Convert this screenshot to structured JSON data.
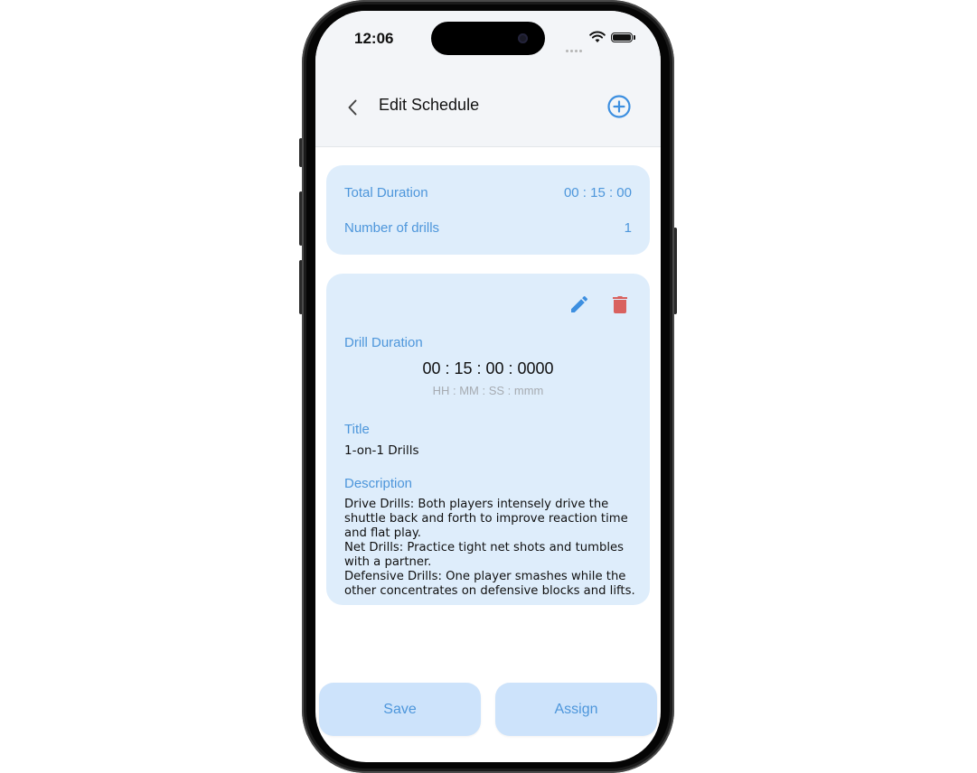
{
  "status_bar": {
    "time": "12:06"
  },
  "nav": {
    "title": "Edit Schedule"
  },
  "summary": {
    "total_duration_label": "Total Duration",
    "total_duration_value": "00 : 15 : 00",
    "drills_count_label": "Number of drills",
    "drills_count_value": "1"
  },
  "drill": {
    "duration_label": "Drill Duration",
    "duration_value": "00 : 15 : 00 : 0000",
    "duration_format": "HH : MM : SS : mmm",
    "title_label": "Title",
    "title_value": "1-on-1 Drills",
    "description_label": "Description",
    "description_value": "Drive Drills: Both players intensely drive the shuttle back and forth to improve reaction time and flat play.\nNet Drills: Practice tight net shots and tumbles with a partner.\nDefensive Drills: One player smashes while the other concentrates on defensive blocks and lifts."
  },
  "actions": {
    "save_label": "Save",
    "assign_label": "Assign"
  },
  "colors": {
    "accent": "#4d96db",
    "card_bg": "#deedfb",
    "button_bg": "#cde3fb",
    "delete": "#d9625f"
  },
  "icons": {
    "back": "chevron-left-icon",
    "add": "plus-circle-icon",
    "edit": "pencil-icon",
    "delete": "trash-icon"
  }
}
